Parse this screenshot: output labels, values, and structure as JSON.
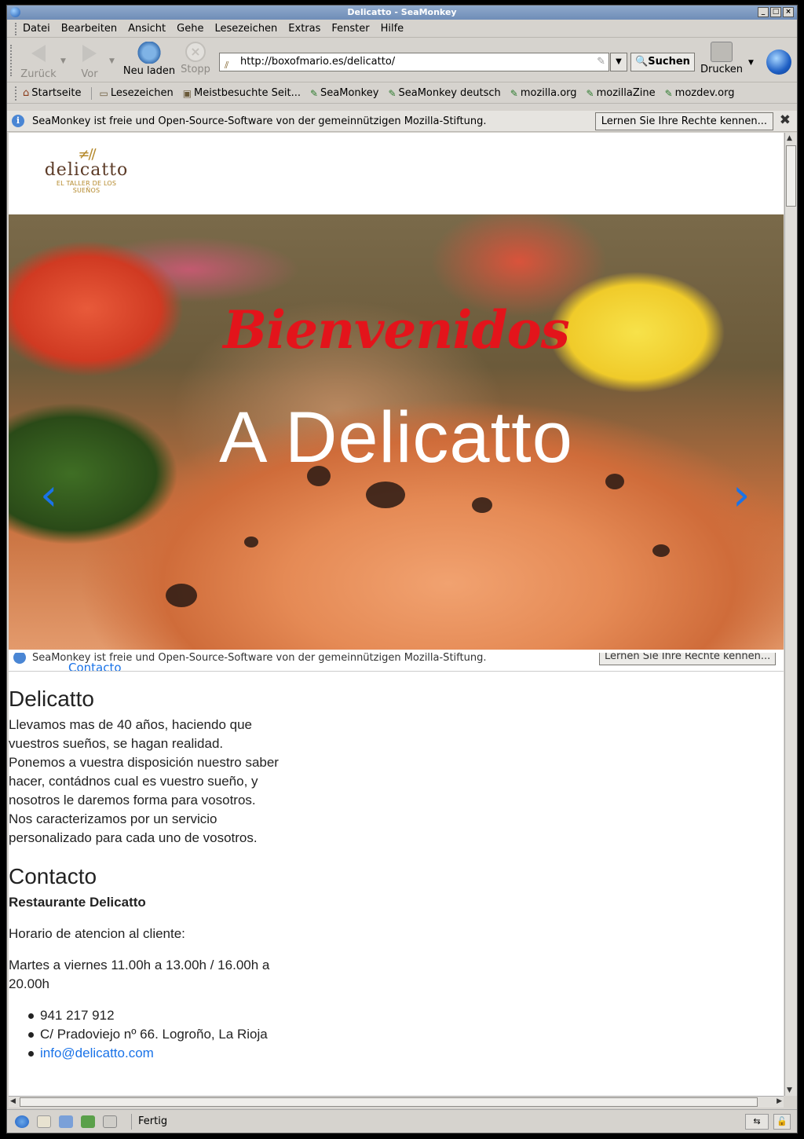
{
  "window": {
    "title": "Delicatto - SeaMonkey",
    "controls": [
      "_",
      "□",
      "×"
    ]
  },
  "menu": [
    "Datei",
    "Bearbeiten",
    "Ansicht",
    "Gehe",
    "Lesezeichen",
    "Extras",
    "Fenster",
    "Hilfe"
  ],
  "nav": {
    "back": "Zurück",
    "forward": "Vor",
    "reload": "Neu laden",
    "stop": "Stopp",
    "url": "http://boxofmario.es/delicatto/",
    "search": "Suchen",
    "print": "Drucken"
  },
  "bookmarks": {
    "home": "Startseite",
    "folder1": "Lesezeichen",
    "folder2": "Meistbesuchte Seit...",
    "links": [
      "SeaMonkey",
      "SeaMonkey deutsch",
      "mozilla.org",
      "mozillaZine",
      "mozdev.org"
    ]
  },
  "notification": {
    "text": "SeaMonkey ist freie und Open-Source-Software von der gemeinnützigen Mozilla-Stiftung.",
    "button": "Lernen Sie Ihre Rechte kennen...",
    "close": "✖"
  },
  "logo": {
    "name": "delicatto",
    "tagline": "EL TALLER DE LOS SUEÑOS"
  },
  "hero": {
    "welcome": "Bienvenidos",
    "headline": "A Delicatto",
    "prev": "‹",
    "next": "›"
  },
  "ghost": {
    "partial_link": "Contacto"
  },
  "about": {
    "title": "Delicatto",
    "p1": "Llevamos mas de 40 años, haciendo que vuestros sueños, se hagan realidad.",
    "p2": "Ponemos a vuestra disposición nuestro saber hacer, contádnos cual es vuestro sueño, y nosotros le daremos forma para vosotros.",
    "p3": "Nos caracterizamos por un servicio personalizado para cada uno de vosotros."
  },
  "contact": {
    "title": "Contacto",
    "name": "Restaurante Delicatto",
    "hours_label": "Horario de atencion al cliente:",
    "hours": "Martes a viernes 11.00h a 13.00h / 16.00h a 20.00h",
    "phone": "941 217 912",
    "address": "C/ Pradoviejo nº 66. Logroño, La Rioja",
    "email": "info@delicatto.com"
  },
  "status": {
    "text": "Fertig"
  },
  "colors": {
    "welcome": "#e3141b",
    "link": "#1a73e8",
    "logo_gold": "#b4882a"
  }
}
